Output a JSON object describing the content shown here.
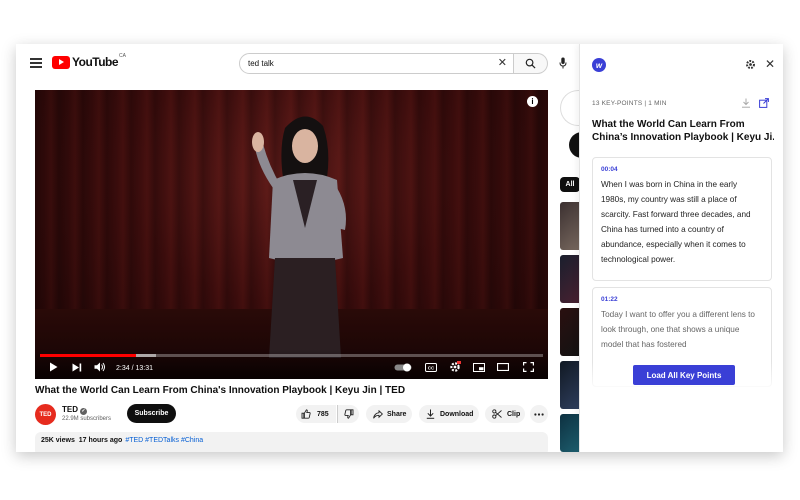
{
  "header": {
    "logo_text": "YouTube",
    "logo_superscript": "CA",
    "search_value": "ted talk"
  },
  "video": {
    "current_time": "2:34",
    "duration": "13:31",
    "timecode": "2:34 / 13:31",
    "progress_fraction": 0.19,
    "buffer_fraction": 0.23
  },
  "details": {
    "title": "What the World Can Learn From China's Innovation Playbook | Keyu Jin | TED",
    "channel_avatar_text": "TED",
    "channel_name": "TED",
    "subscribers": "22.9M subscribers",
    "subscribe_label": "Subscribe",
    "likes": "785",
    "share_label": "Share",
    "download_label": "Download",
    "clip_label": "Clip",
    "views": "25K views",
    "posted": "17 hours ago",
    "tags": "#TED #TEDTalks #China"
  },
  "sidebar": {
    "chip_all": "All"
  },
  "panel": {
    "meta": "13 KEY-POINTS | 1 MIN",
    "title": "What the World Can Learn From China's Innovation Playbook | Keyu Ji...",
    "load_button": "Load All Key Points",
    "accent": "#3a3fd6",
    "points": [
      {
        "time": "00:04",
        "text": "When I was born in China in the early 1980s, my country was still a place of scarcity. Fast forward three decades, and China has turned into a country of abundance, especially when it comes to technological power."
      },
      {
        "time": "01:22",
        "text": "Today I want to offer you a different lens to look through, one that shows a unique model that has fostered"
      }
    ]
  },
  "colors": {
    "youtube_red": "#ff0000",
    "ted_red": "#e62b1e"
  }
}
